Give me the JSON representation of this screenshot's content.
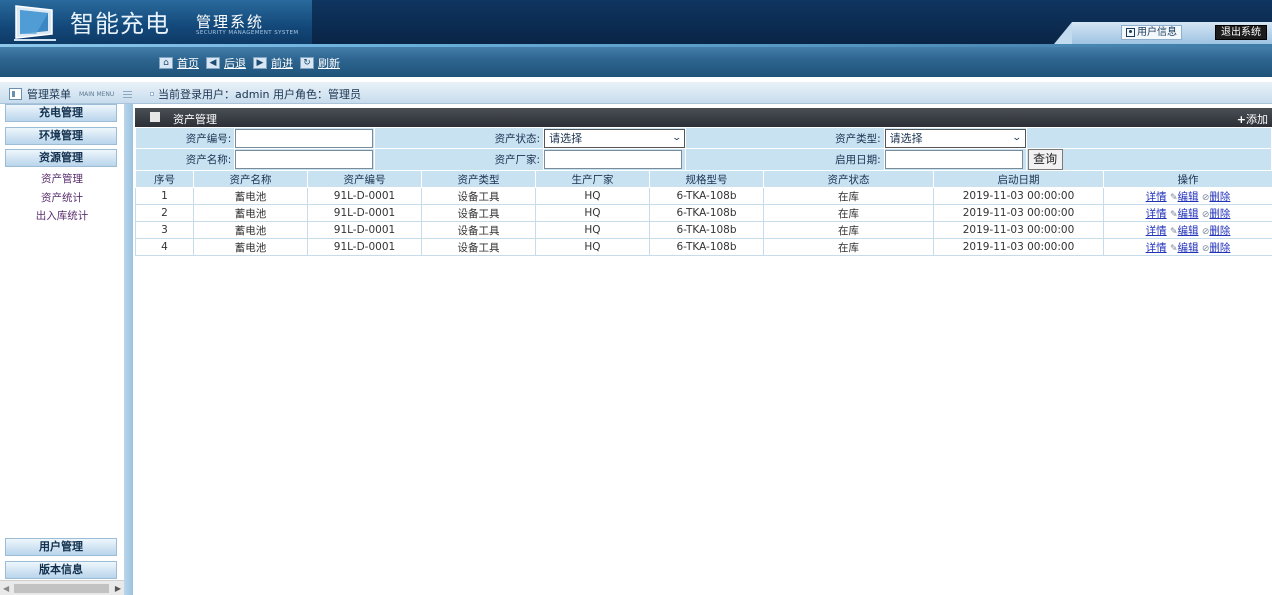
{
  "header": {
    "brand": "智能充电",
    "system_name": "管理系统",
    "system_name_en": "SECURITY MANAGEMENT SYSTEM",
    "user_info_label": "用户信息",
    "exit_label": "退出系统"
  },
  "nav": {
    "home": "首页",
    "back": "后退",
    "forward": "前进",
    "refresh": "刷新"
  },
  "status": {
    "menu_title": "管理菜单",
    "menu_title_en": "MAIN MENU",
    "login_text": "当前登录用户：admin  用户角色：管理员"
  },
  "sidebar": {
    "groups": [
      {
        "label": "充电管理"
      },
      {
        "label": "环境管理"
      },
      {
        "label": "资源管理"
      }
    ],
    "sub_items": [
      {
        "label": "资产管理"
      },
      {
        "label": "资产统计"
      },
      {
        "label": "出入库统计"
      }
    ],
    "bottom_groups": [
      {
        "label": "用户管理"
      },
      {
        "label": "版本信息"
      }
    ]
  },
  "panel": {
    "title": "资产管理",
    "add_label": "添加"
  },
  "search": {
    "asset_no_label": "资产编号:",
    "asset_no_value": "",
    "asset_status_label": "资产状态:",
    "asset_status_value": "请选择",
    "asset_type_label": "资产类型:",
    "asset_type_value": "请选择",
    "asset_name_label": "资产名称:",
    "asset_name_value": "",
    "manufacturer_label": "资产厂家:",
    "manufacturer_value": "",
    "start_date_label": "启用日期:",
    "start_date_value": "",
    "query_label": "查询"
  },
  "table": {
    "headers": [
      "序号",
      "资产名称",
      "资产编号",
      "资产类型",
      "生产厂家",
      "规格型号",
      "资产状态",
      "启动日期",
      "操作"
    ],
    "rows": [
      [
        "1",
        "蓄电池",
        "91L-D-0001",
        "设备工具",
        "HQ",
        "6-TKA-108b",
        "在库",
        "2019-11-03 00:00:00"
      ],
      [
        "2",
        "蓄电池",
        "91L-D-0001",
        "设备工具",
        "HQ",
        "6-TKA-108b",
        "在库",
        "2019-11-03 00:00:00"
      ],
      [
        "3",
        "蓄电池",
        "91L-D-0001",
        "设备工具",
        "HQ",
        "6-TKA-108b",
        "在库",
        "2019-11-03 00:00:00"
      ],
      [
        "4",
        "蓄电池",
        "91L-D-0001",
        "设备工具",
        "HQ",
        "6-TKA-108b",
        "在库",
        "2019-11-03 00:00:00"
      ]
    ],
    "actions": {
      "detail": "详情",
      "edit": "编辑",
      "delete": "删除"
    }
  }
}
